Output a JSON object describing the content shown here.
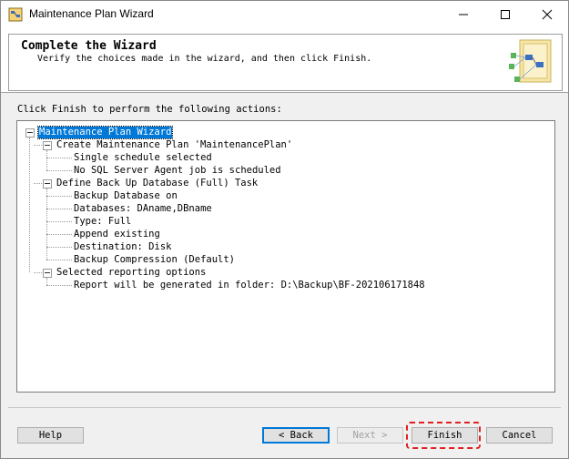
{
  "window": {
    "title": "Maintenance Plan Wizard",
    "accent": "#0078d7"
  },
  "header": {
    "title": "Complete the Wizard",
    "subtitle": "Verify the choices made in the wizard, and then click Finish."
  },
  "intro": "Click Finish to perform the following actions:",
  "tree": {
    "root": "Maintenance Plan Wizard",
    "groups": [
      {
        "label": "Create Maintenance Plan 'MaintenancePlan'",
        "items": [
          "Single schedule selected",
          "No SQL Server Agent job is scheduled"
        ]
      },
      {
        "label": "Define Back Up Database (Full) Task",
        "items": [
          "Backup Database on",
          "Databases: DAname,DBname",
          "Type: Full",
          "Append existing",
          "Destination: Disk",
          "Backup Compression (Default)"
        ]
      },
      {
        "label": "Selected reporting options",
        "items": [
          "Report will be generated in folder: D:\\Backup\\BF-202106171848"
        ]
      }
    ]
  },
  "buttons": {
    "help": "Help",
    "back": "< Back",
    "next": "Next >",
    "finish": "Finish",
    "cancel": "Cancel"
  },
  "annotation_color": "#e02020"
}
